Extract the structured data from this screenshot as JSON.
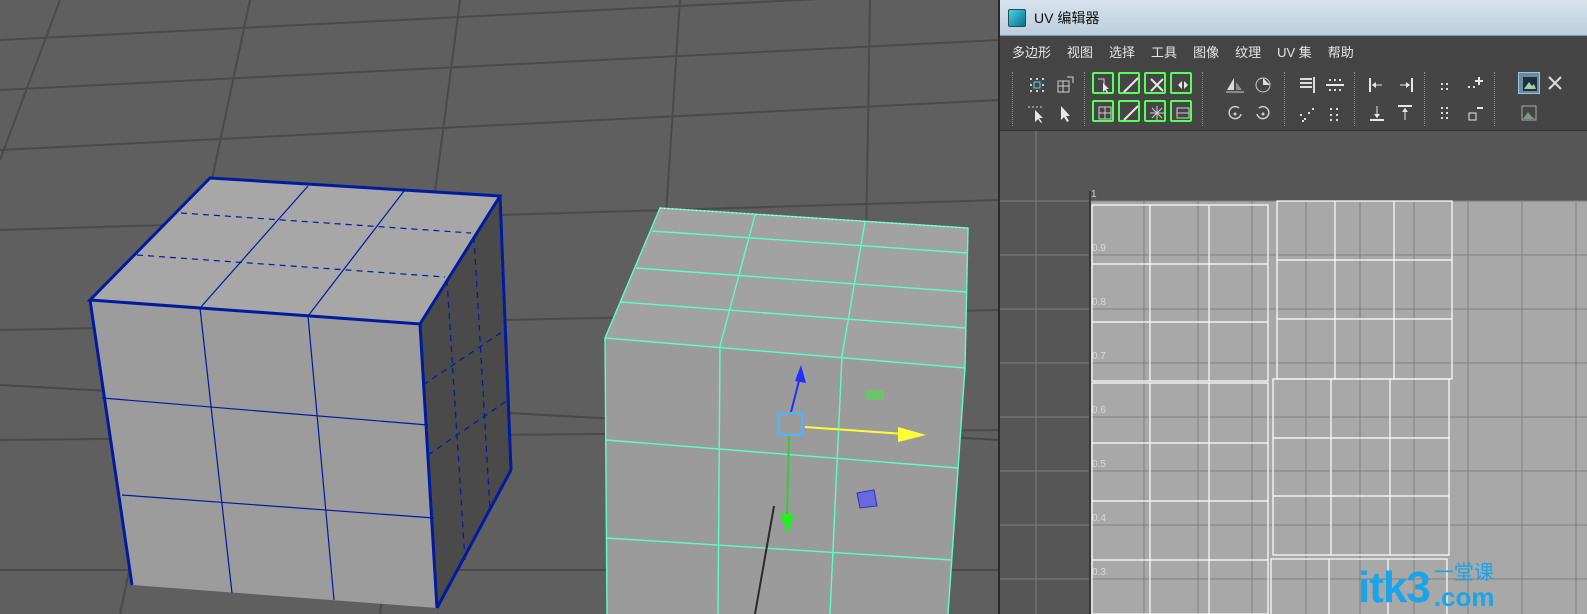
{
  "uv_editor": {
    "title": "UV 编辑器",
    "menu": [
      "多边形",
      "视图",
      "选择",
      "工具",
      "图像",
      "纹理",
      "UV 集",
      "帮助"
    ],
    "axis_top_label": "1",
    "axis_labels": [
      "0.9",
      "0.8",
      "0.7",
      "0.6",
      "0.5",
      "0.4",
      "0.3"
    ]
  },
  "icons": {
    "app": "uv-editor-app-icon",
    "toolbar": [
      "grid-cut-icon",
      "grid-sew-icon",
      "select-edge-icon",
      "select-uv-icon",
      "flip-icon",
      "rotate-icon",
      "align-icon",
      "distribute-icon",
      "snap-icon",
      "layout-icon",
      "image-display-icon"
    ]
  },
  "watermark": {
    "main": "itk3",
    "cn": "一堂课",
    "com": ".com"
  },
  "colors": {
    "selected_wireframe": "#001aa0",
    "active_wireframe": "#5affc8",
    "highlight_green": "#55ff55",
    "uv_shell": "#ffffff",
    "watermark": "#1aa4ea"
  }
}
